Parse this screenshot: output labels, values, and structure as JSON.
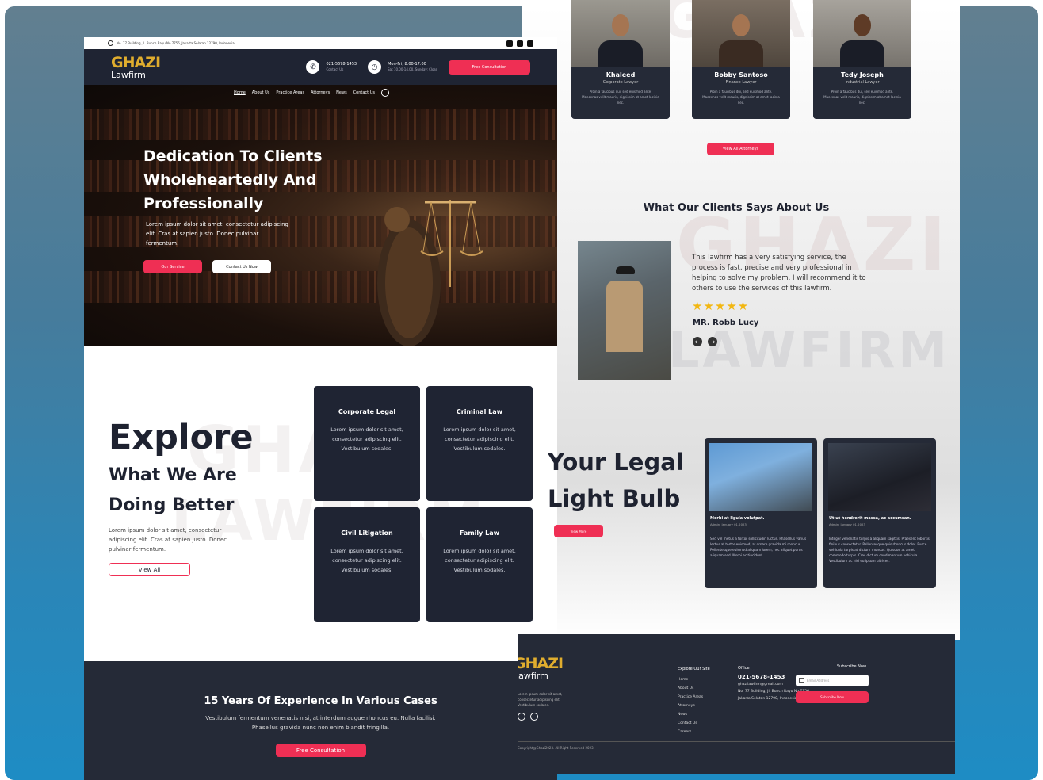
{
  "colors": {
    "accent": "#ef2f54",
    "dark": "#1f2433",
    "gold": "#e0ad2e",
    "star": "#f2b712"
  },
  "topbar": {
    "address": "No. 77 Building, Jl. Bunch Rayu No.7756, Jakarta Selatan 12790, Indonesia",
    "icons": [
      "facebook-icon",
      "instagram-icon",
      "youtube-icon"
    ]
  },
  "brand": {
    "name": "GHAZI",
    "sub": "Lawfirm"
  },
  "header": {
    "phone": "021-5678-1453",
    "phone_sub": "Contact Us",
    "hours": "Mon-Fri, 8.00-17.00",
    "hours_sub": "Sat 10.00-14.00, Sunday: Close",
    "cta": "Free Consultation"
  },
  "nav": {
    "items": [
      "Home",
      "About Us",
      "Practice Areas",
      "Attorneys",
      "News",
      "Contact Us"
    ]
  },
  "hero": {
    "title": "Dedication To Clients Wholeheartedly And Professionally",
    "text": "Lorem ipsum dolor sit amet, consectetur adipiscing elit. Cras at sapien justo. Donec pulvinar fermentum.",
    "btn_primary": "Our Service",
    "btn_secondary": "Contact Us Now"
  },
  "explore": {
    "title": "Explore",
    "subtitle": "What We Are Doing Better",
    "text": "Lorem ipsum dolor sit amet, consectetur adipiscing elit. Cras at sapien justo. Donec pulvinar fermentum.",
    "btn": "View All",
    "watermark": [
      "GHAZI",
      "LAWFIRM"
    ],
    "cards": [
      {
        "title": "Corporate Legal",
        "text": "Lorem ipsum dolor sit amet, consectetur adipiscing elit. Vestibulum sodales."
      },
      {
        "title": "Criminal Law",
        "text": "Lorem ipsum dolor sit amet, consectetur adipiscing elit. Vestibulum sodales."
      },
      {
        "title": "Civil Litigation",
        "text": "Lorem ipsum dolor sit amet, consectetur adipiscing elit. Vestibulum sodales."
      },
      {
        "title": "Family Law",
        "text": "Lorem ipsum dolor sit amet, consectetur adipiscing elit. Vestibulum sodales."
      }
    ]
  },
  "cta": {
    "title": "15 Years Of Experience In Various Cases",
    "text": "Vestibulum fermentum venenatis nisi, at interdum augue rhoncus eu. Nulla facilisi. Phasellus gravida nunc non enim blandit fringilla.",
    "btn": "Free Consultation"
  },
  "attorneys": {
    "items": [
      {
        "name": "Khaleed",
        "role": "Corporate Lawyer",
        "text": "Proin a faucibus dui, sed euismod ante. Maecenas velit mauris, dignissim at amet lacinia nec."
      },
      {
        "name": "Bobby Santoso",
        "role": "Finance Lawyer",
        "text": "Proin a faucibus dui, sed euismod ante. Maecenas velit mauris, dignissim at amet lacinia nec."
      },
      {
        "name": "Tedy Joseph",
        "role": "Industrial Lawyer",
        "text": "Proin a faucibus dui, sed euismod ante. Maecenas velit mauris, dignissim at amet lacinia nec."
      }
    ],
    "btn": "View All Attorneys"
  },
  "testimonial": {
    "title": "What Our Clients Says About Us",
    "quote": "This lawfirm has a very satisfying service, the process is fast, precise and very professional in helping to solve my problem. I will recommend it to others to use the services of this lawfirm.",
    "stars": "★★★★★",
    "rating": 5,
    "name": "MR. Robb Lucy",
    "watermark": [
      "GHAZI",
      "LAWFIRM"
    ]
  },
  "blog": {
    "title_line1": "Your Legal",
    "title_line2": "Light Bulb",
    "btn": "View More",
    "posts": [
      {
        "title": "Morbi at ligula volutpat.",
        "meta": "Admin, January 01,2023",
        "text": "Sed vel metus a tortor sollicitudin luctus. Phasellus varius lectus at tortor euismod, at ornare gravida mi rhoncus. Pellentesque euismod aliquam lorem, nec aliquet purus aliquam sed. Morbi ac tincidunt."
      },
      {
        "title": "Ut ut hendrerit massa, ac accumsan.",
        "meta": "Admin, January 01,2023",
        "text": "Integer venenatis turpis a aliquam sagittis. Praesent lobortis finibus consectetur. Pellentesque quis rhoncus dolor. Fusce vehicula turpis at dictum rhoncus. Quisque at amet commodo turpis. Cras dictum condimentum vehicula. Vestibulum ac nisl eu ipsum ultrices."
      }
    ]
  },
  "footer": {
    "desc": "Lorem ipsum dolor sit amet, consectetur adipiscing elit. Vestibulum sodales.",
    "explore_title": "Explore Our Site",
    "links": [
      "Home",
      "About Us",
      "Practice Areas",
      "Attorneys",
      "News",
      "Contact Us",
      "Careers"
    ],
    "office_title": "Office",
    "phone": "021-5678-1453",
    "email": "ghazilawfirm@gmail.com",
    "address": "No. 77 Building, Jl. Bunch Rayu No.7756, Jakarta Selatan 12790, Indonesia",
    "subscribe_title": "Subscribe Now",
    "email_placeholder": "Email Address",
    "subscribe_btn": "Subscribe Now",
    "copyright": "Copyright@Ghazi2023. All Right Reserved 2023"
  }
}
